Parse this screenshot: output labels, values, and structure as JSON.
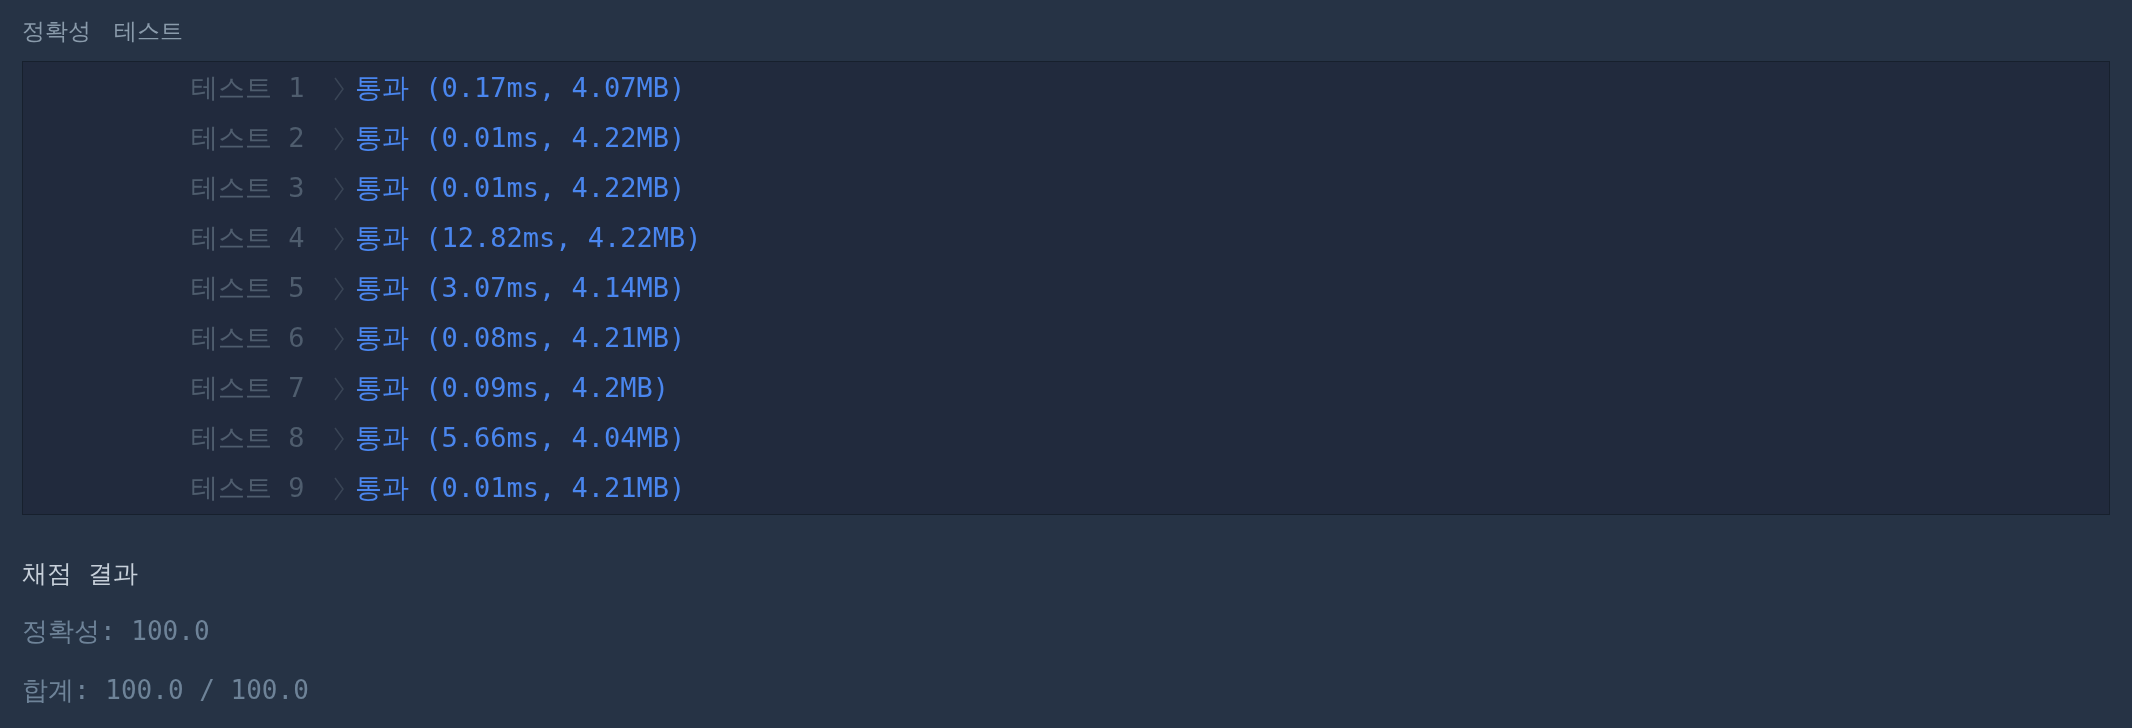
{
  "section_title": "정확성 테스트",
  "tests": [
    {
      "label": "테스트 1",
      "result": "통과 (0.17ms, 4.07MB)",
      "passed": true
    },
    {
      "label": "테스트 2",
      "result": "통과 (0.01ms, 4.22MB)",
      "passed": true
    },
    {
      "label": "테스트 3",
      "result": "통과 (0.01ms, 4.22MB)",
      "passed": true
    },
    {
      "label": "테스트 4",
      "result": "통과 (12.82ms, 4.22MB)",
      "passed": true
    },
    {
      "label": "테스트 5",
      "result": "통과 (3.07ms, 4.14MB)",
      "passed": true
    },
    {
      "label": "테스트 6",
      "result": "통과 (0.08ms, 4.21MB)",
      "passed": true
    },
    {
      "label": "테스트 7",
      "result": "통과 (0.09ms, 4.2MB)",
      "passed": true
    },
    {
      "label": "테스트 8",
      "result": "통과 (5.66ms, 4.04MB)",
      "passed": true
    },
    {
      "label": "테스트 9",
      "result": "통과 (0.01ms, 4.21MB)",
      "passed": true
    }
  ],
  "grading": {
    "title": "채점 결과",
    "lines": [
      "정확성: 100.0",
      "합계: 100.0 / 100.0"
    ]
  }
}
